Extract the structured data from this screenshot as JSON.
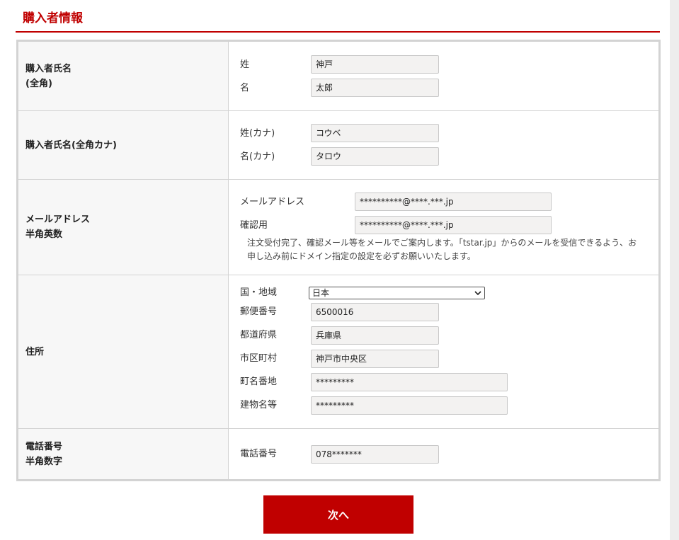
{
  "section": {
    "title": "購入者情報"
  },
  "rows": {
    "name": {
      "label": "購入者氏名\n(全角)",
      "last_label": "姓",
      "last_value": "神戸",
      "first_label": "名",
      "first_value": "太郎"
    },
    "kana": {
      "label": "購入者氏名(全角カナ)",
      "last_label": "姓(カナ)",
      "last_value": "コウベ",
      "first_label": "名(カナ)",
      "first_value": "タロウ"
    },
    "email": {
      "label": "メールアドレス\n半角英数",
      "email_label": "メールアドレス",
      "email_value": "**********@****.***.jp",
      "confirm_label": "確認用",
      "confirm_value": "**********@****.***.jp",
      "note": "注文受付完了、確認メール等をメールでご案内します。「tstar.jp」からのメールを受信できるよう、お申し込み前にドメイン指定の設定を必ずお願いいたします。"
    },
    "address": {
      "label": "住所",
      "country_label": "国・地域",
      "country_value": "日本",
      "zip_label": "郵便番号",
      "zip_value": "6500016",
      "pref_label": "都道府県",
      "pref_value": "兵庫県",
      "city_label": "市区町村",
      "city_value": "神戸市中央区",
      "street_label": "町名番地",
      "street_value": "*********",
      "building_label": "建物名等",
      "building_value": "*********"
    },
    "phone": {
      "label": "電話番号\n半角数字",
      "phone_label": "電話番号",
      "phone_value": "078*******"
    }
  },
  "actions": {
    "next_label": "次へ"
  },
  "colors": {
    "accent": "#c00000",
    "label_bg": "#f7f7f7",
    "input_bg": "#f3f2f1",
    "border": "#d3d3d3"
  }
}
